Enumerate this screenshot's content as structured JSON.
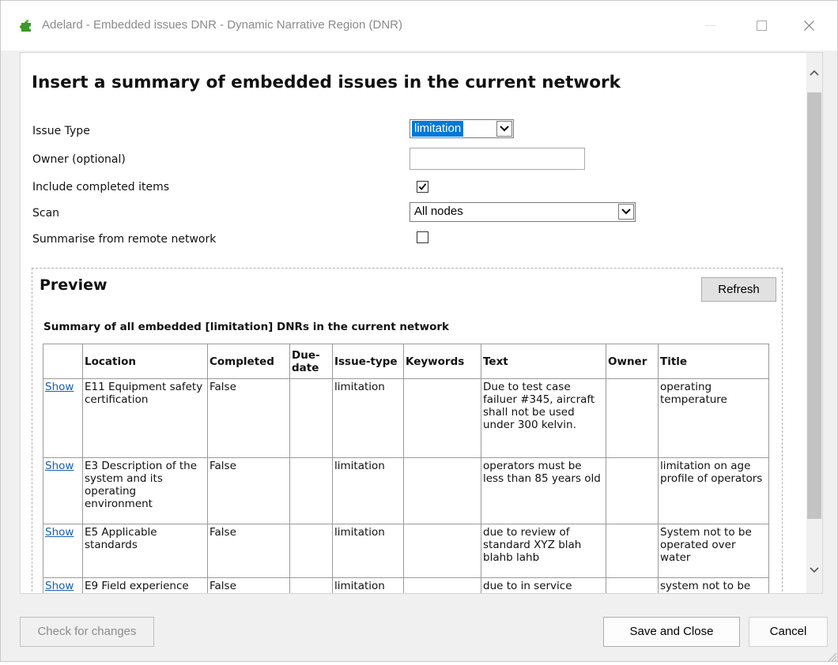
{
  "window": {
    "title": "Adelard - Embedded issues DNR - Dynamic Narrative Region (DNR)"
  },
  "page": {
    "heading": "Insert a summary of embedded issues in the current network"
  },
  "form": {
    "issue_type_label": "Issue Type",
    "issue_type_value": "limitation",
    "owner_label": "Owner (optional)",
    "owner_value": "",
    "include_completed_label": "Include completed items",
    "include_completed_checked": true,
    "scan_label": "Scan",
    "scan_value": "All nodes",
    "remote_label": "Summarise from remote network",
    "remote_checked": false
  },
  "preview": {
    "title": "Preview",
    "refresh_label": "Refresh",
    "summary_title": "Summary of all embedded [limitation] DNRs in the current network",
    "columns": [
      "",
      "Location",
      "Completed",
      "Due-date",
      "Issue-type",
      "Keywords",
      "Text",
      "Owner",
      "Title"
    ],
    "rows": [
      {
        "link": "Show",
        "location": "E11 Equipment safety certification",
        "completed": "False",
        "due_date": "",
        "issue_type": "limitation",
        "keywords": "",
        "text": "Due to test case failuer #345, aircraft shall not be used under 300 kelvin.",
        "owner": "",
        "title": "operating temperature"
      },
      {
        "link": "Show",
        "location": "E3 Description of the system and its operating environment",
        "completed": "False",
        "due_date": "",
        "issue_type": "limitation",
        "keywords": "",
        "text": "operators must be less than 85 years old",
        "owner": "",
        "title": "limitation on age profile of operators"
      },
      {
        "link": "Show",
        "location": "E5 Applicable standards",
        "completed": "False",
        "due_date": "",
        "issue_type": "limitation",
        "keywords": "",
        "text": "due to review of standard XYZ blah blahb lahb",
        "owner": "",
        "title": "System not to be operated over water"
      },
      {
        "link": "Show",
        "location": "E9 Field experience",
        "completed": "False",
        "due_date": "",
        "issue_type": "limitation",
        "keywords": "",
        "text": "due to in service incident",
        "owner": "",
        "title": "system not to be operated"
      }
    ]
  },
  "footer": {
    "check_changes_label": "Check for changes",
    "save_close_label": "Save and Close",
    "cancel_label": "Cancel"
  },
  "colors": {
    "selection_blue": "#0078d7",
    "link_blue": "#1a5fb4",
    "icon_green": "#3a9a2a"
  },
  "icons": {
    "app": "puzzle-icon",
    "minimize": "minimize-icon",
    "maximize": "maximize-icon",
    "close": "close-icon"
  }
}
